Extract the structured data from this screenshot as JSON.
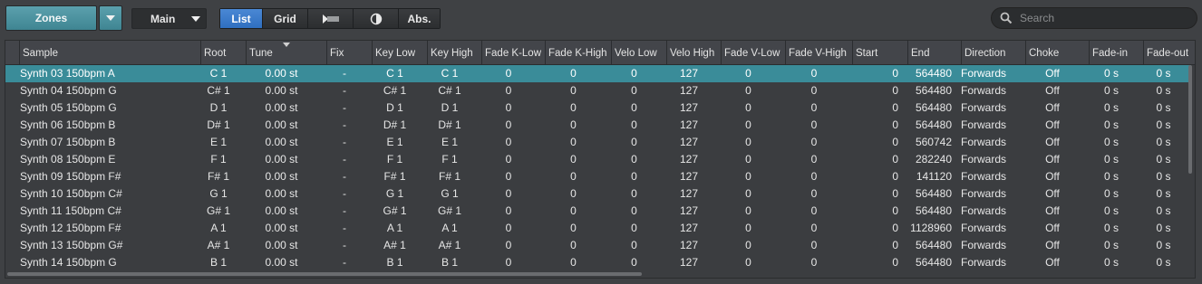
{
  "toolbar": {
    "zones_label": "Zones",
    "main_label": "Main",
    "view_list": "List",
    "view_grid": "Grid",
    "abs_label": "Abs.",
    "search_placeholder": "Search"
  },
  "table": {
    "columns": [
      "Sample",
      "Root",
      "Tune",
      "Fix",
      "Key Low",
      "Key High",
      "Fade K-Low",
      "Fade K-High",
      "Velo Low",
      "Velo High",
      "Fade V-Low",
      "Fade V-High",
      "Start",
      "End",
      "Direction",
      "Choke",
      "Fade-in",
      "Fade-out"
    ],
    "rows": [
      [
        "Synth 03 150bpm A",
        "C 1",
        "0.00 st",
        "-",
        "C 1",
        "C 1",
        "0",
        "0",
        "0",
        "127",
        "0",
        "0",
        "0",
        "564480",
        "Forwards",
        "Off",
        "0 s",
        "0 s"
      ],
      [
        "Synth 04 150bpm G",
        "C# 1",
        "0.00 st",
        "-",
        "C# 1",
        "C# 1",
        "0",
        "0",
        "0",
        "127",
        "0",
        "0",
        "0",
        "564480",
        "Forwards",
        "Off",
        "0 s",
        "0 s"
      ],
      [
        "Synth 05 150bpm G",
        "D 1",
        "0.00 st",
        "-",
        "D 1",
        "D 1",
        "0",
        "0",
        "0",
        "127",
        "0",
        "0",
        "0",
        "564480",
        "Forwards",
        "Off",
        "0 s",
        "0 s"
      ],
      [
        "Synth 06 150bpm B",
        "D# 1",
        "0.00 st",
        "-",
        "D# 1",
        "D# 1",
        "0",
        "0",
        "0",
        "127",
        "0",
        "0",
        "0",
        "564480",
        "Forwards",
        "Off",
        "0 s",
        "0 s"
      ],
      [
        "Synth 07 150bpm B",
        "E 1",
        "0.00 st",
        "-",
        "E 1",
        "E 1",
        "0",
        "0",
        "0",
        "127",
        "0",
        "0",
        "0",
        "560742",
        "Forwards",
        "Off",
        "0 s",
        "0 s"
      ],
      [
        "Synth 08 150bpm E",
        "F 1",
        "0.00 st",
        "-",
        "F 1",
        "F 1",
        "0",
        "0",
        "0",
        "127",
        "0",
        "0",
        "0",
        "282240",
        "Forwards",
        "Off",
        "0 s",
        "0 s"
      ],
      [
        "Synth 09 150bpm F#",
        "F# 1",
        "0.00 st",
        "-",
        "F# 1",
        "F# 1",
        "0",
        "0",
        "0",
        "127",
        "0",
        "0",
        "0",
        "141120",
        "Forwards",
        "Off",
        "0 s",
        "0 s"
      ],
      [
        "Synth 10 150bpm C#",
        "G 1",
        "0.00 st",
        "-",
        "G 1",
        "G 1",
        "0",
        "0",
        "0",
        "127",
        "0",
        "0",
        "0",
        "564480",
        "Forwards",
        "Off",
        "0 s",
        "0 s"
      ],
      [
        "Synth 11 150bpm C#",
        "G# 1",
        "0.00 st",
        "-",
        "G# 1",
        "G# 1",
        "0",
        "0",
        "0",
        "127",
        "0",
        "0",
        "0",
        "564480",
        "Forwards",
        "Off",
        "0 s",
        "0 s"
      ],
      [
        "Synth 12 150bpm F#",
        "A 1",
        "0.00 st",
        "-",
        "A 1",
        "A 1",
        "0",
        "0",
        "0",
        "127",
        "0",
        "0",
        "0",
        "1128960",
        "Forwards",
        "Off",
        "0 s",
        "0 s"
      ],
      [
        "Synth 13 150bpm G#",
        "A# 1",
        "0.00 st",
        "-",
        "A# 1",
        "A# 1",
        "0",
        "0",
        "0",
        "127",
        "0",
        "0",
        "0",
        "564480",
        "Forwards",
        "Off",
        "0 s",
        "0 s"
      ],
      [
        "Synth 14 150bpm G",
        "B 1",
        "0.00 st",
        "-",
        "B 1",
        "B 1",
        "0",
        "0",
        "0",
        "127",
        "0",
        "0",
        "0",
        "564480",
        "Forwards",
        "Off",
        "0 s",
        "0 s"
      ]
    ],
    "selected_row": 0
  },
  "colors": {
    "selection": "#3a8c99",
    "zones_button": "#4f95a2",
    "active_toggle": "#3b7bcc"
  }
}
